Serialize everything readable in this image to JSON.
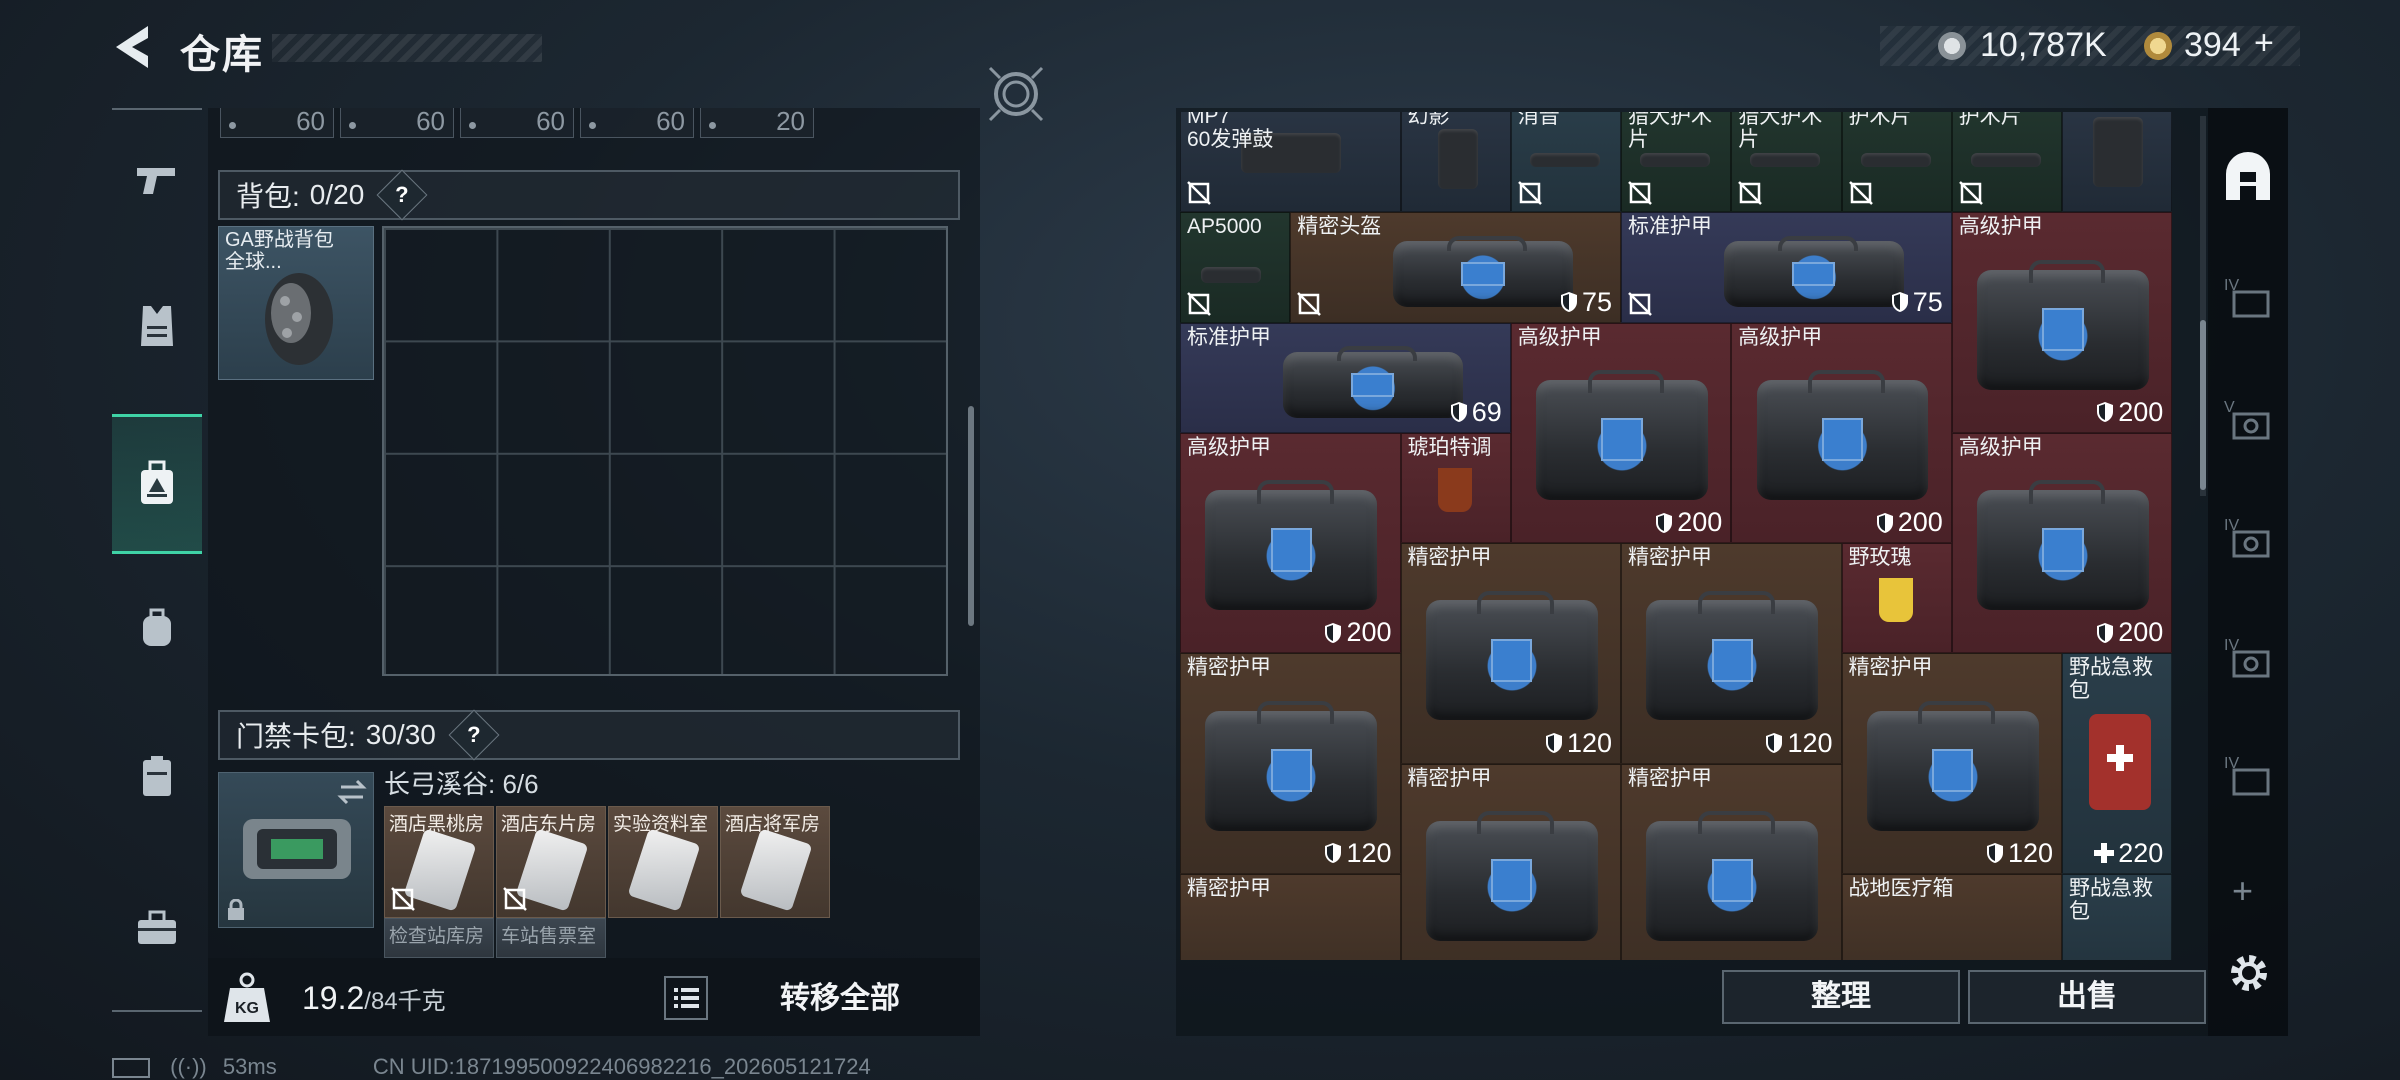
{
  "header": {
    "title": "仓库"
  },
  "currency": {
    "coins": "10,787K",
    "bonds": "394",
    "bonds_plus": "+"
  },
  "left_panel": {
    "ammo_strip": [
      "60",
      "60",
      "60",
      "60",
      "20"
    ],
    "backpack": {
      "label": "背包:",
      "count": "0/20",
      "help": "?",
      "item_name": "GA野战背包\n全球...",
      "item_name_line1": "GA野战背包",
      "item_name_line2": "全球..."
    },
    "keycard": {
      "label": "门禁卡包:",
      "count": "30/30",
      "help": "?",
      "map_label": "长弓溪谷: 6/6",
      "keys": [
        "酒店黑桃房",
        "酒店东片房",
        "实验资料室",
        "酒店将军房"
      ],
      "keys_row2": [
        "检查站库房",
        "车站售票室"
      ]
    },
    "weight": {
      "current": "19.2",
      "max": "/84千克"
    },
    "transfer_all": "转移全部"
  },
  "status": {
    "ping": "53ms",
    "uid": "CN UID:18719950092240698221​6_202605121724"
  },
  "inventory": {
    "cells": [
      {
        "label": "MP7\n60发弹鼓",
        "color": "c-dark",
        "value": ""
      },
      {
        "label": "幻影",
        "color": "c-dark",
        "value": ""
      },
      {
        "label": "消音",
        "color": "c-teal",
        "value": ""
      },
      {
        "label": "猎犬护木片",
        "color": "c-green",
        "value": ""
      },
      {
        "label": "猎犬护木片",
        "color": "c-green",
        "value": ""
      },
      {
        "label": "护木片",
        "color": "c-green",
        "value": ""
      },
      {
        "label": "护木片",
        "color": "c-green",
        "value": ""
      },
      {
        "label": "",
        "color": "c-dark",
        "value": ""
      },
      {
        "label": "AP5000",
        "color": "c-green",
        "value": ""
      },
      {
        "label": "精密头盔",
        "color": "c-brown",
        "value": "75"
      },
      {
        "label": "标准护甲",
        "color": "c-purp",
        "value": "75"
      },
      {
        "label": "高级护甲",
        "color": "c-red",
        "value": "200"
      },
      {
        "label": "标准护甲",
        "color": "c-purp",
        "value": "69"
      },
      {
        "label": "高级护甲",
        "color": "c-red",
        "value": "200"
      },
      {
        "label": "高级护甲",
        "color": "c-red",
        "value": "200"
      },
      {
        "label": "高级护甲",
        "color": "c-red",
        "value": "200"
      },
      {
        "label": "琥珀特调",
        "color": "c-red",
        "value": ""
      },
      {
        "label": "高级护甲",
        "color": "c-red",
        "value": "200"
      },
      {
        "label": "精密护甲",
        "color": "c-brown",
        "value": "120"
      },
      {
        "label": "精密护甲",
        "color": "c-brown",
        "value": "120"
      },
      {
        "label": "野玫瑰",
        "color": "c-red",
        "value": ""
      },
      {
        "label": "精密护甲",
        "color": "c-brown",
        "value": "120"
      },
      {
        "label": "精密护甲",
        "color": "c-brown",
        "value": "120"
      },
      {
        "label": "野战急救包",
        "color": "c-teal",
        "value": "220"
      },
      {
        "label": "精密护甲",
        "color": "c-brown",
        "value": ""
      },
      {
        "label": "精密护甲",
        "color": "c-brown",
        "value": ""
      },
      {
        "label": "精密护甲",
        "color": "c-brown",
        "value": ""
      },
      {
        "label": "战地医疗箱",
        "color": "c-brown",
        "value": ""
      },
      {
        "label": "野战急救包",
        "color": "c-teal",
        "value": ""
      }
    ]
  },
  "actions": {
    "tidy": "整理",
    "sell": "出售"
  },
  "right_column": {
    "plus": "+"
  }
}
